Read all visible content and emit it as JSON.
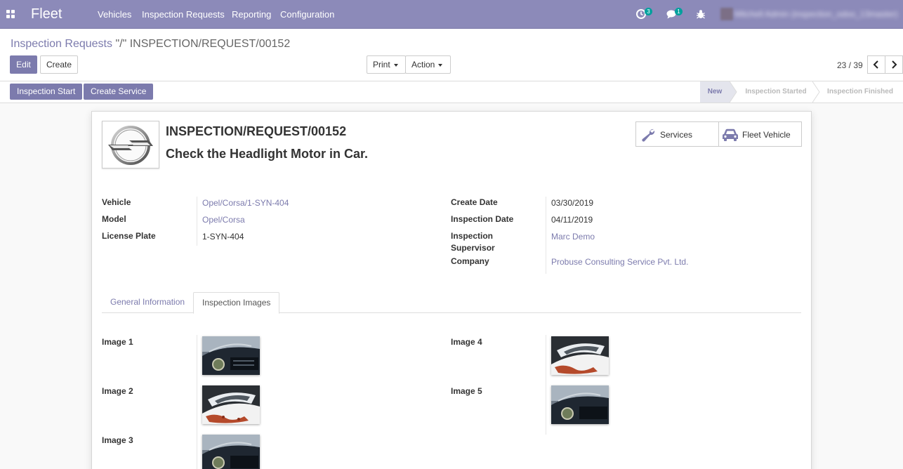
{
  "navbar": {
    "app_title": "Fleet",
    "menu": [
      "Vehicles",
      "Inspection Requests",
      "Reporting",
      "Configuration"
    ],
    "activity_count": "3",
    "message_count": "1",
    "user_name": "Mitchell Admin (inspection_odoo_13master)",
    "accent": "#8c8ab9"
  },
  "control_panel": {
    "breadcrumb_parent": "Inspection Requests",
    "breadcrumb_sep": "\"/\"",
    "breadcrumb_current": "INSPECTION/REQUEST/00152",
    "edit_label": "Edit",
    "create_label": "Create",
    "print_label": "Print",
    "action_label": "Action",
    "pager_value": "23 / 39"
  },
  "statusbar": {
    "buttons": [
      "Inspection Start",
      "Create Service"
    ],
    "stages": [
      "New",
      "Inspection Started",
      "Inspection Finished"
    ],
    "current_stage": "New"
  },
  "record": {
    "reference": "INSPECTION/REQUEST/00152",
    "description": "Check the Headlight Motor in Car.",
    "smart_buttons": [
      {
        "label": "Services",
        "icon": "wrench-icon"
      },
      {
        "label": "Fleet Vehicle",
        "icon": "car-icon"
      }
    ],
    "left_fields": [
      {
        "label": "Vehicle",
        "value": "Opel/Corsa/1-SYN-404",
        "link": true
      },
      {
        "label": "Model",
        "value": "Opel/Corsa",
        "link": true
      },
      {
        "label": "License Plate",
        "value": "1-SYN-404",
        "link": false
      }
    ],
    "right_fields": [
      {
        "label": "Create Date",
        "value": "03/30/2019",
        "link": false
      },
      {
        "label": "Inspection Date",
        "value": "04/11/2019",
        "link": false
      },
      {
        "label": "Inspection Supervisor",
        "value": "Marc Demo",
        "link": true
      },
      {
        "label": "Company",
        "value": "Probuse Consulting Service Pvt. Ltd.",
        "link": true
      }
    ]
  },
  "tabs": [
    "General Information",
    "Inspection Images"
  ],
  "active_tab": "Inspection Images",
  "images": {
    "left": [
      {
        "label": "Image 1",
        "photo": "car-grille-photo"
      },
      {
        "label": "Image 2",
        "photo": "headlight-photo"
      },
      {
        "label": "Image 3",
        "photo": "car-grille-photo"
      }
    ],
    "right": [
      {
        "label": "Image 4",
        "photo": "headlight-photo"
      },
      {
        "label": "Image 5",
        "photo": "car-grille-photo"
      }
    ]
  }
}
